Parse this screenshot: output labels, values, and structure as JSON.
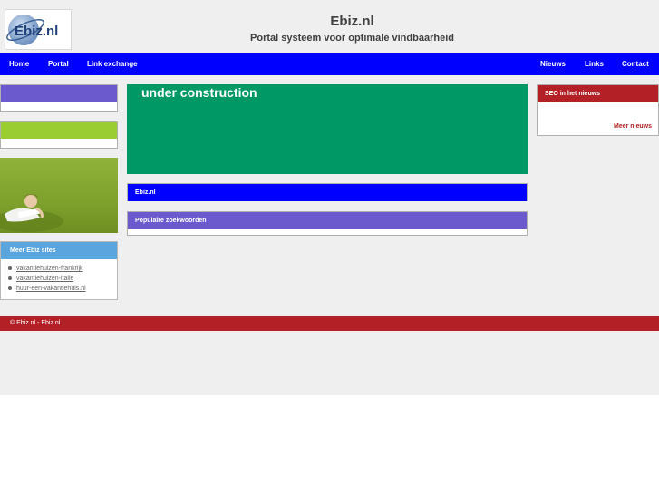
{
  "header": {
    "logo_text": "Ebiz.nl",
    "title": "Ebiz.nl",
    "subtitle": "Portal systeem voor optimale vindbaarheid"
  },
  "nav": {
    "left": [
      "Home",
      "Portal",
      "Link exchange"
    ],
    "right": [
      "Nieuws",
      "Links",
      "Contact"
    ]
  },
  "main": {
    "banner_text": "under construction",
    "box1_title": "Ebiz.nl",
    "box2_title": "Populaire zoekwoorden"
  },
  "sidebar_left": {
    "meer_title": "Meer Ebiz sites",
    "meer_links": [
      "vakantiehuizen-frankrijk",
      "vakantiehuizen-italie",
      "huur-een-vakantiehuis.nl"
    ]
  },
  "sidebar_right": {
    "news_title": "SEO in het nieuws",
    "more_link": "Meer nieuws"
  },
  "footer": {
    "text": "© Ebiz.nl - Ebiz.nl"
  },
  "colors": {
    "nav_blue": "#0000ff",
    "purple": "#6a5acd",
    "lime": "#9acd32",
    "green": "#009966",
    "red": "#b32025",
    "light_blue": "#5aa5dd"
  }
}
